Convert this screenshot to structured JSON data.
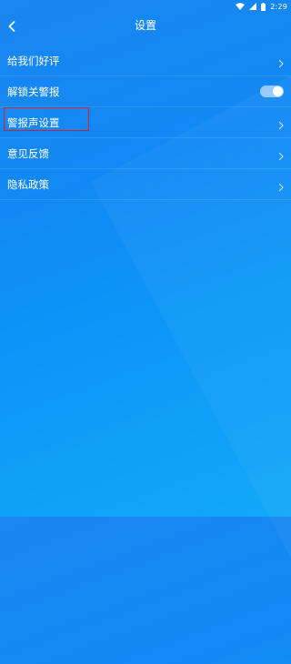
{
  "status_bar": {
    "time": "2:29",
    "icons": [
      "wifi-icon",
      "signal-icon",
      "battery-icon"
    ]
  },
  "header": {
    "title": "设置",
    "back_icon": "chevron-left-icon"
  },
  "settings": {
    "items": [
      {
        "label": "给我们好评",
        "control": "chevron"
      },
      {
        "label": "解锁关警报",
        "control": "toggle",
        "toggle_on": true
      },
      {
        "label": "警报声设置",
        "control": "chevron"
      },
      {
        "label": "意见反馈",
        "control": "chevron"
      },
      {
        "label": "隐私政策",
        "control": "chevron"
      }
    ]
  },
  "colors": {
    "background_start": "#1a86f0",
    "background_end": "#12a8f8",
    "highlight_border": "#d31f2e"
  }
}
